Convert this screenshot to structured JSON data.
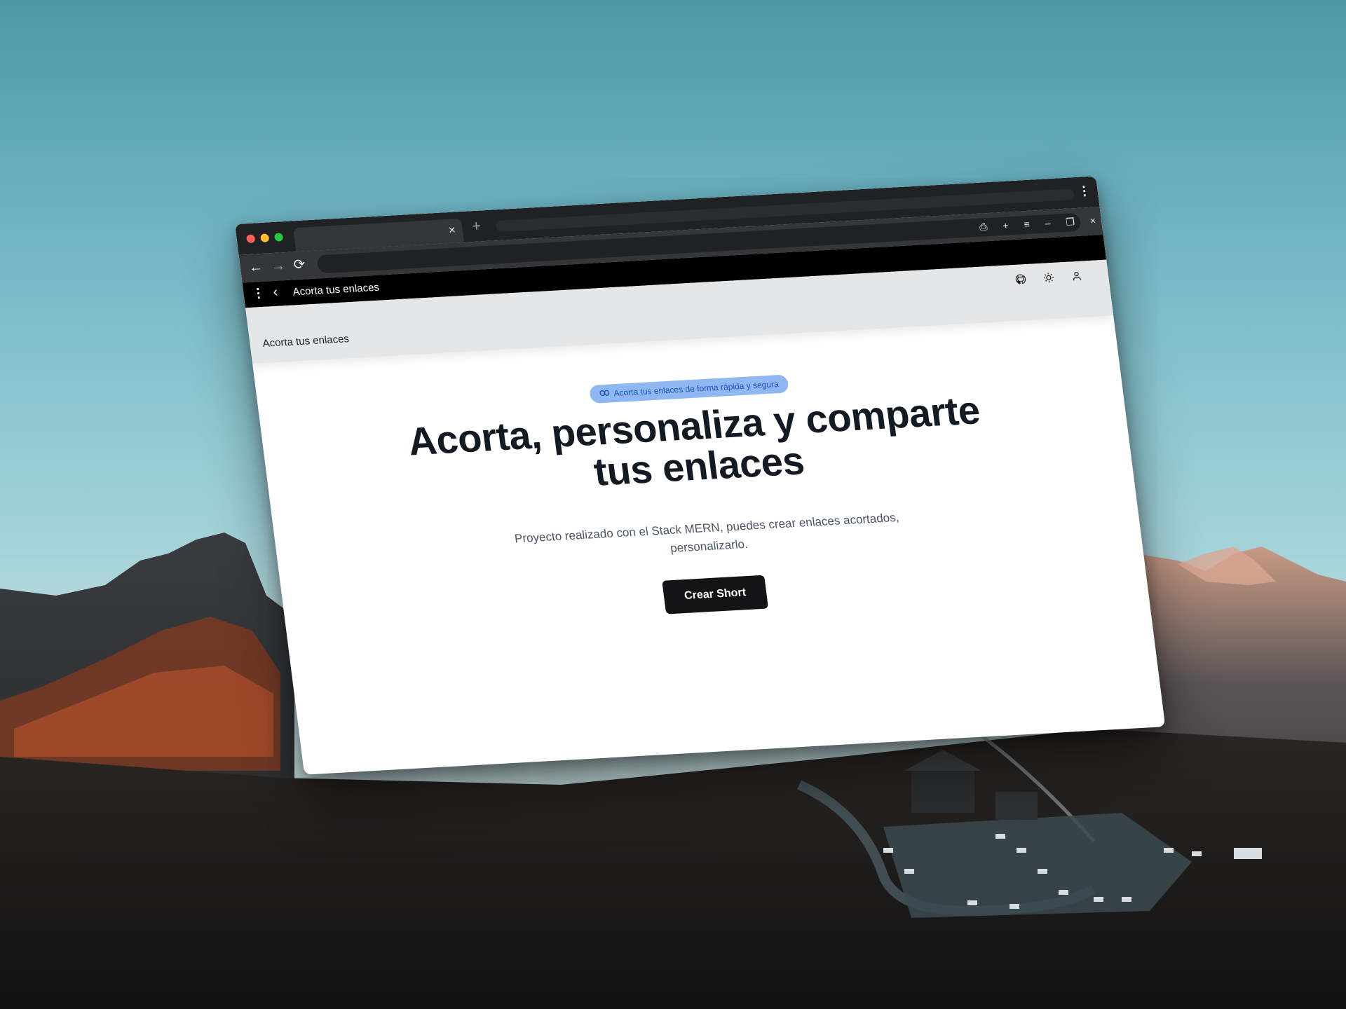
{
  "browser": {
    "tab_close": "×",
    "new_tab": "+",
    "tab_menu": "⋮",
    "nav": {
      "back": "←",
      "forward": "→",
      "reload": "⟳"
    },
    "window_controls": [
      "⎙",
      "+",
      "≡",
      "–",
      "❐",
      "×"
    ]
  },
  "appbar": {
    "menu": "⋮",
    "back": "‹",
    "title": "Acorta tus enlaces"
  },
  "header": {
    "brand": "Acorta tus enlaces",
    "icons": [
      "github-icon",
      "sun-icon",
      "user-icon"
    ]
  },
  "hero": {
    "badge": "Acorta tus enlaces de forma rápida y segura",
    "title_line1": "Acorta, personaliza y comparte",
    "title_line2": "tus enlaces",
    "subtitle": "Proyecto realizado con el Stack MERN, puedes crear enlaces acortados, personalizarlo.",
    "cta": "Crear Short"
  },
  "colors": {
    "badge_bg": "#8fb8f2",
    "badge_text": "#1f4fb8",
    "button_bg": "#141416",
    "header_bg": "#e5e6e8"
  }
}
